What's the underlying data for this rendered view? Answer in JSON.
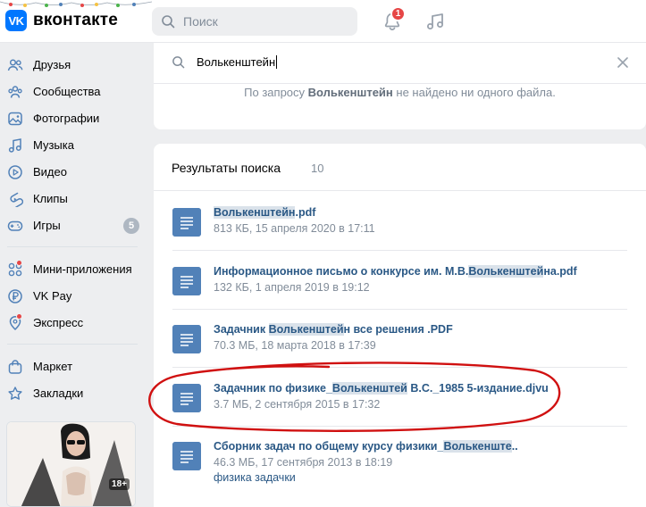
{
  "app": {
    "logo_letters": "VK",
    "logo_text": "вконтакте",
    "brand_color": "#0077ff"
  },
  "header": {
    "search_placeholder": "Поиск",
    "notification_badge": "1"
  },
  "sidebar": {
    "items": [
      {
        "label": "Друзья",
        "icon": "friends-icon"
      },
      {
        "label": "Сообщества",
        "icon": "communities-icon"
      },
      {
        "label": "Фотографии",
        "icon": "photos-icon"
      },
      {
        "label": "Музыка",
        "icon": "music-icon"
      },
      {
        "label": "Видео",
        "icon": "video-icon"
      },
      {
        "label": "Клипы",
        "icon": "clips-icon"
      },
      {
        "label": "Игры",
        "icon": "games-icon",
        "counter": "5"
      },
      {
        "label": "Мини-приложения",
        "icon": "mini-apps-icon"
      },
      {
        "label": "VK Pay",
        "icon": "vkpay-icon"
      },
      {
        "label": "Экспресс",
        "icon": "express-icon"
      },
      {
        "label": "Маркет",
        "icon": "market-icon"
      },
      {
        "label": "Закладки",
        "icon": "bookmarks-icon"
      }
    ],
    "ad_tag": "18+"
  },
  "doc_search": {
    "value": "Волькенштейн",
    "not_found_prefix": "По запросу ",
    "not_found_query": "Волькенштейн",
    "not_found_suffix": " не найдено ни одного файла."
  },
  "results": {
    "title": "Результаты поиска",
    "count": "10",
    "files": [
      {
        "pre": "",
        "hl": "Волькенштейн",
        "post": ".pdf",
        "meta": "813 КБ, 15 апреля 2020 в 17:11"
      },
      {
        "pre": "Информационное письмо о конкурсе им. М.В.",
        "hl": "Волькенштей",
        "post": "на.pdf",
        "meta": "132 КБ, 1 апреля 2019 в 19:12"
      },
      {
        "pre": "Задачник ",
        "hl": "Волькенштей",
        "post": "н все решения .PDF",
        "meta": "70.3 МБ, 18 марта 2018 в 17:39"
      },
      {
        "pre": "Задачник по физике_",
        "hl": "Волькенштей",
        "post": " В.С._1985 5-издание.djvu",
        "meta": "3.7 МБ, 2 сентября 2015 в 17:32"
      },
      {
        "pre": "Сборник задач по общему курсу физики_",
        "hl": "Волькенште",
        "post": "..",
        "meta": "46.3 МБ, 17 сентября 2013 в 18:19",
        "extra": "физика задачки"
      }
    ]
  },
  "colors": {
    "link": "#2a5885",
    "muted": "#818c99",
    "highlight": "#dae2ea",
    "annotation": "#d01010"
  }
}
